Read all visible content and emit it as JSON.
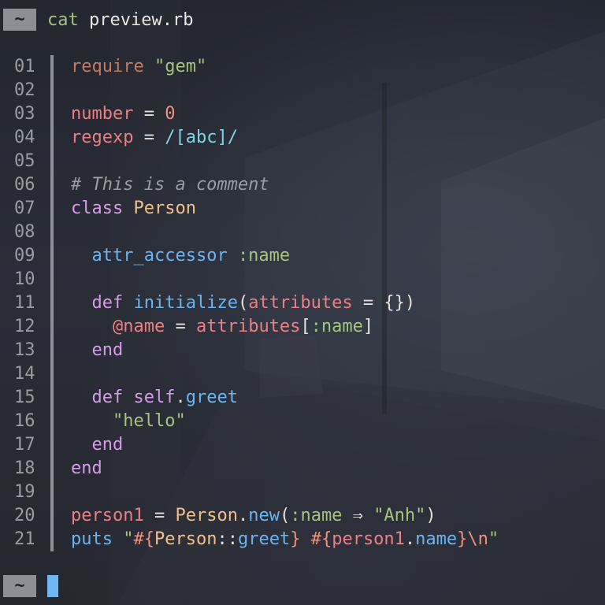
{
  "prompt": {
    "badge": "~",
    "command": "cat",
    "argument": "preview.rb"
  },
  "code_lines": [
    {
      "num": "01"
    },
    {
      "num": "02"
    },
    {
      "num": "03"
    },
    {
      "num": "04"
    },
    {
      "num": "05"
    },
    {
      "num": "06"
    },
    {
      "num": "07"
    },
    {
      "num": "08"
    },
    {
      "num": "09"
    },
    {
      "num": "10"
    },
    {
      "num": "11"
    },
    {
      "num": "12"
    },
    {
      "num": "13"
    },
    {
      "num": "14"
    },
    {
      "num": "15"
    },
    {
      "num": "16"
    },
    {
      "num": "17"
    },
    {
      "num": "18"
    },
    {
      "num": "19"
    },
    {
      "num": "20"
    },
    {
      "num": "21"
    }
  ],
  "code": {
    "l01": [
      [
        "kw-req",
        "require"
      ],
      [
        "op",
        " "
      ],
      [
        "str",
        "\"gem\""
      ]
    ],
    "l02": [],
    "l03": [
      [
        "var",
        "number"
      ],
      [
        "op",
        " = "
      ],
      [
        "num",
        "0"
      ]
    ],
    "l04": [
      [
        "var",
        "regexp"
      ],
      [
        "op",
        " = "
      ],
      [
        "re",
        "/[abc]/"
      ]
    ],
    "l05": [],
    "l06": [
      [
        "comment",
        "# This is a comment"
      ]
    ],
    "l07": [
      [
        "kw",
        "class"
      ],
      [
        "op",
        " "
      ],
      [
        "const",
        "Person"
      ]
    ],
    "l08": [],
    "l09": [
      [
        "op",
        "  "
      ],
      [
        "fn",
        "attr_accessor"
      ],
      [
        "op",
        " "
      ],
      [
        "sym",
        ":name"
      ]
    ],
    "l10": [],
    "l11": [
      [
        "op",
        "  "
      ],
      [
        "kw",
        "def"
      ],
      [
        "op",
        " "
      ],
      [
        "fn",
        "initialize"
      ],
      [
        "op",
        "("
      ],
      [
        "var",
        "attributes"
      ],
      [
        "op",
        " = {})"
      ]
    ],
    "l12": [
      [
        "op",
        "    "
      ],
      [
        "ivar",
        "@name"
      ],
      [
        "op",
        " = "
      ],
      [
        "var",
        "attributes"
      ],
      [
        "op",
        "["
      ],
      [
        "sym",
        ":name"
      ],
      [
        "op",
        "]"
      ]
    ],
    "l13": [
      [
        "op",
        "  "
      ],
      [
        "kw",
        "end"
      ]
    ],
    "l14": [],
    "l15": [
      [
        "op",
        "  "
      ],
      [
        "kw",
        "def"
      ],
      [
        "op",
        " "
      ],
      [
        "kw",
        "self"
      ],
      [
        "op",
        "."
      ],
      [
        "fn",
        "greet"
      ]
    ],
    "l16": [
      [
        "op",
        "    "
      ],
      [
        "str",
        "\"hello\""
      ]
    ],
    "l17": [
      [
        "op",
        "  "
      ],
      [
        "kw",
        "end"
      ]
    ],
    "l18": [
      [
        "kw",
        "end"
      ]
    ],
    "l19": [],
    "l20": [
      [
        "var",
        "person1"
      ],
      [
        "op",
        " = "
      ],
      [
        "const",
        "Person"
      ],
      [
        "op",
        "."
      ],
      [
        "fn",
        "new"
      ],
      [
        "op",
        "("
      ],
      [
        "sym",
        ":name"
      ],
      [
        "op",
        " ⇒ "
      ],
      [
        "str",
        "\"Anh\""
      ],
      [
        "op",
        ")"
      ]
    ],
    "l21": [
      [
        "fn",
        "puts"
      ],
      [
        "op",
        " "
      ],
      [
        "str",
        "\""
      ],
      [
        "interp",
        "#{"
      ],
      [
        "const",
        "Person"
      ],
      [
        "op",
        "::"
      ],
      [
        "fn",
        "greet"
      ],
      [
        "interp",
        "}"
      ],
      [
        "str",
        " "
      ],
      [
        "interp",
        "#{"
      ],
      [
        "var",
        "person1"
      ],
      [
        "op",
        "."
      ],
      [
        "fn",
        "name"
      ],
      [
        "interp",
        "}"
      ],
      [
        "esc",
        "\\n"
      ],
      [
        "str",
        "\""
      ]
    ]
  },
  "colors": {
    "cursor": "#6fb6f5",
    "badge_bg": "#8c8f96"
  }
}
